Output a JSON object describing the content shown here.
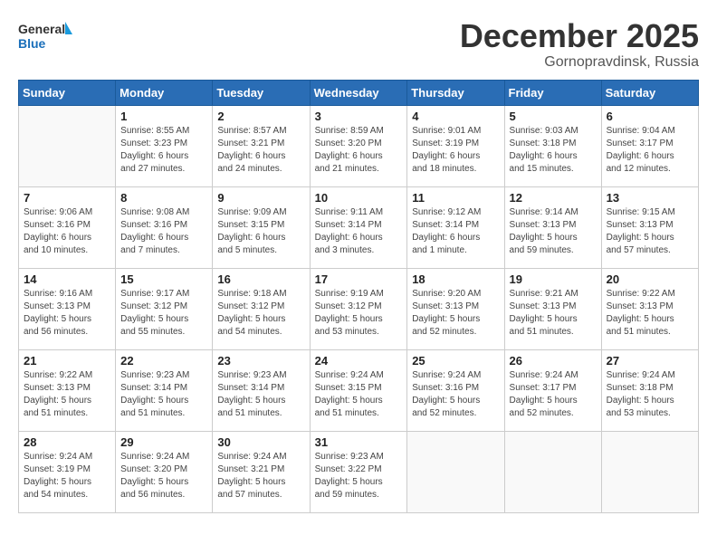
{
  "logo": {
    "general": "General",
    "blue": "Blue"
  },
  "title": {
    "month": "December 2025",
    "location": "Gornopravdinsk, Russia"
  },
  "weekdays": [
    "Sunday",
    "Monday",
    "Tuesday",
    "Wednesday",
    "Thursday",
    "Friday",
    "Saturday"
  ],
  "weeks": [
    [
      {
        "day": "",
        "info": ""
      },
      {
        "day": "1",
        "info": "Sunrise: 8:55 AM\nSunset: 3:23 PM\nDaylight: 6 hours\nand 27 minutes."
      },
      {
        "day": "2",
        "info": "Sunrise: 8:57 AM\nSunset: 3:21 PM\nDaylight: 6 hours\nand 24 minutes."
      },
      {
        "day": "3",
        "info": "Sunrise: 8:59 AM\nSunset: 3:20 PM\nDaylight: 6 hours\nand 21 minutes."
      },
      {
        "day": "4",
        "info": "Sunrise: 9:01 AM\nSunset: 3:19 PM\nDaylight: 6 hours\nand 18 minutes."
      },
      {
        "day": "5",
        "info": "Sunrise: 9:03 AM\nSunset: 3:18 PM\nDaylight: 6 hours\nand 15 minutes."
      },
      {
        "day": "6",
        "info": "Sunrise: 9:04 AM\nSunset: 3:17 PM\nDaylight: 6 hours\nand 12 minutes."
      }
    ],
    [
      {
        "day": "7",
        "info": "Sunrise: 9:06 AM\nSunset: 3:16 PM\nDaylight: 6 hours\nand 10 minutes."
      },
      {
        "day": "8",
        "info": "Sunrise: 9:08 AM\nSunset: 3:16 PM\nDaylight: 6 hours\nand 7 minutes."
      },
      {
        "day": "9",
        "info": "Sunrise: 9:09 AM\nSunset: 3:15 PM\nDaylight: 6 hours\nand 5 minutes."
      },
      {
        "day": "10",
        "info": "Sunrise: 9:11 AM\nSunset: 3:14 PM\nDaylight: 6 hours\nand 3 minutes."
      },
      {
        "day": "11",
        "info": "Sunrise: 9:12 AM\nSunset: 3:14 PM\nDaylight: 6 hours\nand 1 minute."
      },
      {
        "day": "12",
        "info": "Sunrise: 9:14 AM\nSunset: 3:13 PM\nDaylight: 5 hours\nand 59 minutes."
      },
      {
        "day": "13",
        "info": "Sunrise: 9:15 AM\nSunset: 3:13 PM\nDaylight: 5 hours\nand 57 minutes."
      }
    ],
    [
      {
        "day": "14",
        "info": "Sunrise: 9:16 AM\nSunset: 3:13 PM\nDaylight: 5 hours\nand 56 minutes."
      },
      {
        "day": "15",
        "info": "Sunrise: 9:17 AM\nSunset: 3:12 PM\nDaylight: 5 hours\nand 55 minutes."
      },
      {
        "day": "16",
        "info": "Sunrise: 9:18 AM\nSunset: 3:12 PM\nDaylight: 5 hours\nand 54 minutes."
      },
      {
        "day": "17",
        "info": "Sunrise: 9:19 AM\nSunset: 3:12 PM\nDaylight: 5 hours\nand 53 minutes."
      },
      {
        "day": "18",
        "info": "Sunrise: 9:20 AM\nSunset: 3:13 PM\nDaylight: 5 hours\nand 52 minutes."
      },
      {
        "day": "19",
        "info": "Sunrise: 9:21 AM\nSunset: 3:13 PM\nDaylight: 5 hours\nand 51 minutes."
      },
      {
        "day": "20",
        "info": "Sunrise: 9:22 AM\nSunset: 3:13 PM\nDaylight: 5 hours\nand 51 minutes."
      }
    ],
    [
      {
        "day": "21",
        "info": "Sunrise: 9:22 AM\nSunset: 3:13 PM\nDaylight: 5 hours\nand 51 minutes."
      },
      {
        "day": "22",
        "info": "Sunrise: 9:23 AM\nSunset: 3:14 PM\nDaylight: 5 hours\nand 51 minutes."
      },
      {
        "day": "23",
        "info": "Sunrise: 9:23 AM\nSunset: 3:14 PM\nDaylight: 5 hours\nand 51 minutes."
      },
      {
        "day": "24",
        "info": "Sunrise: 9:24 AM\nSunset: 3:15 PM\nDaylight: 5 hours\nand 51 minutes."
      },
      {
        "day": "25",
        "info": "Sunrise: 9:24 AM\nSunset: 3:16 PM\nDaylight: 5 hours\nand 52 minutes."
      },
      {
        "day": "26",
        "info": "Sunrise: 9:24 AM\nSunset: 3:17 PM\nDaylight: 5 hours\nand 52 minutes."
      },
      {
        "day": "27",
        "info": "Sunrise: 9:24 AM\nSunset: 3:18 PM\nDaylight: 5 hours\nand 53 minutes."
      }
    ],
    [
      {
        "day": "28",
        "info": "Sunrise: 9:24 AM\nSunset: 3:19 PM\nDaylight: 5 hours\nand 54 minutes."
      },
      {
        "day": "29",
        "info": "Sunrise: 9:24 AM\nSunset: 3:20 PM\nDaylight: 5 hours\nand 56 minutes."
      },
      {
        "day": "30",
        "info": "Sunrise: 9:24 AM\nSunset: 3:21 PM\nDaylight: 5 hours\nand 57 minutes."
      },
      {
        "day": "31",
        "info": "Sunrise: 9:23 AM\nSunset: 3:22 PM\nDaylight: 5 hours\nand 59 minutes."
      },
      {
        "day": "",
        "info": ""
      },
      {
        "day": "",
        "info": ""
      },
      {
        "day": "",
        "info": ""
      }
    ]
  ]
}
